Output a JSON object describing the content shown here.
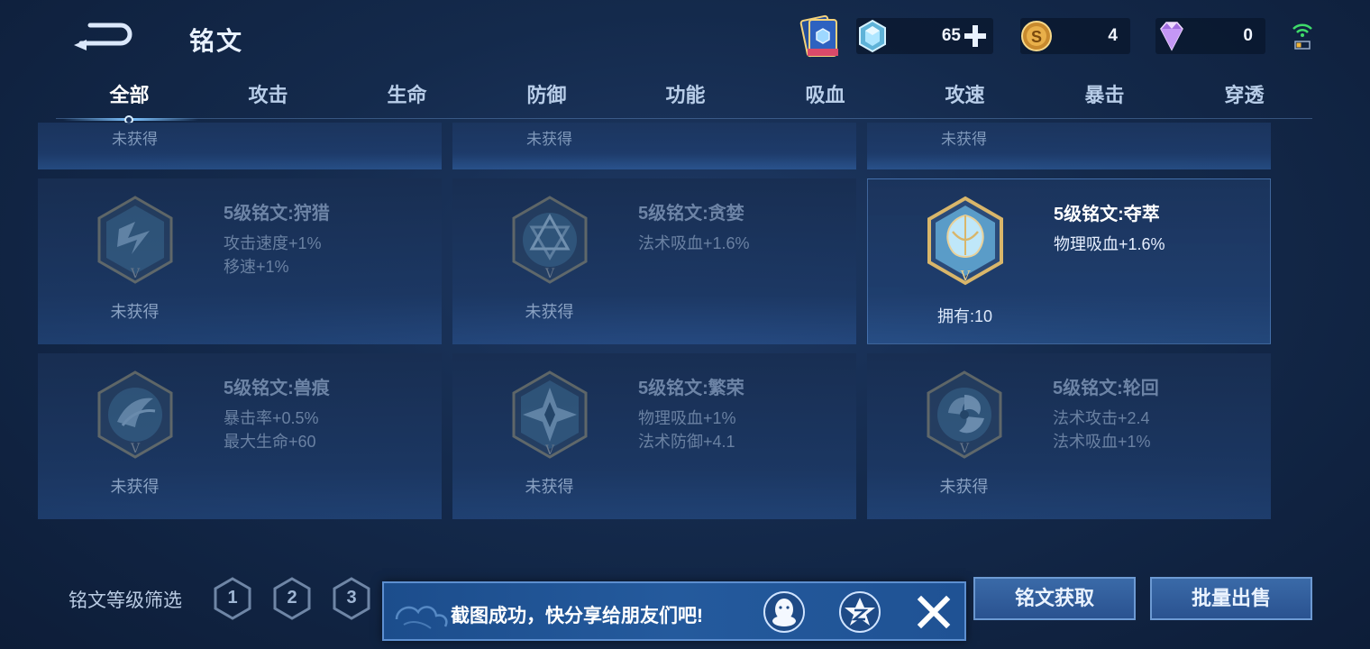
{
  "header": {
    "title": "铭文"
  },
  "currencies": {
    "gem": {
      "icon": "crystal-icon",
      "value": "65"
    },
    "coin": {
      "icon": "gold-coin-icon",
      "value": "4"
    },
    "diamond": {
      "icon": "diamond-icon",
      "value": "0"
    }
  },
  "tabs": [
    {
      "label": "全部",
      "active": true
    },
    {
      "label": "攻击"
    },
    {
      "label": "生命"
    },
    {
      "label": "防御"
    },
    {
      "label": "功能"
    },
    {
      "label": "吸血"
    },
    {
      "label": "攻速"
    },
    {
      "label": "暴击"
    },
    {
      "label": "穿透"
    }
  ],
  "top_row": [
    {
      "status": "未获得"
    },
    {
      "status": "未获得"
    },
    {
      "status": "未获得"
    }
  ],
  "cards": [
    {
      "name": "5级铭文:狩猎",
      "attr1": "攻击速度+1%",
      "attr2": "移速+1%",
      "status": "未获得",
      "owned": false,
      "icon": "hunt-rune-icon"
    },
    {
      "name": "5级铭文:贪婪",
      "attr1": "法术吸血+1.6%",
      "attr2": "",
      "status": "未获得",
      "owned": false,
      "icon": "greed-rune-icon"
    },
    {
      "name": "5级铭文:夺萃",
      "attr1": "物理吸血+1.6%",
      "attr2": "",
      "status": "拥有:10",
      "owned": true,
      "icon": "plunder-rune-icon"
    },
    {
      "name": "5级铭文:兽痕",
      "attr1": "暴击率+0.5%",
      "attr2": "最大生命+60",
      "status": "未获得",
      "owned": false,
      "icon": "beast-mark-rune-icon"
    },
    {
      "name": "5级铭文:繁荣",
      "attr1": "物理吸血+1%",
      "attr2": "法术防御+4.1",
      "status": "未获得",
      "owned": false,
      "icon": "prosperity-rune-icon"
    },
    {
      "name": "5级铭文:轮回",
      "attr1": "法术攻击+2.4",
      "attr2": "法术吸血+1%",
      "status": "未获得",
      "owned": false,
      "icon": "reincarnation-rune-icon"
    }
  ],
  "footer": {
    "level_filter_label": "铭文等级筛选",
    "levels": [
      "1",
      "2",
      "3"
    ],
    "obtain_button": "铭文获取",
    "sell_button": "批量出售"
  },
  "toast": {
    "message": "截图成功，快分享给朋友们吧!",
    "share_targets": [
      "qq-icon",
      "qzone-icon"
    ]
  },
  "colors": {
    "background": "#142a4c",
    "accent": "#7dc3ff",
    "button": "#2a5290",
    "rune_gold": "#c9a45a",
    "rune_cyan": "#8fd4f0"
  }
}
